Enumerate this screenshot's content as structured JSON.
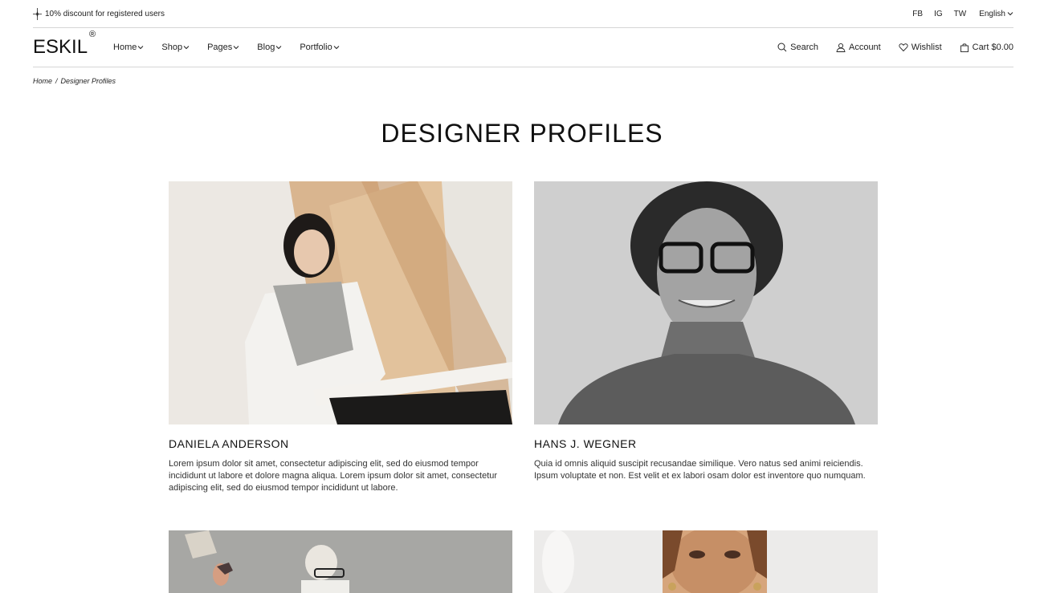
{
  "topbar": {
    "promo": "10% discount for registered users",
    "social": [
      "FB",
      "IG",
      "TW"
    ],
    "language": "English"
  },
  "header": {
    "logo": "ESKIL",
    "logo_mark": "®",
    "nav": [
      {
        "label": "Home"
      },
      {
        "label": "Shop"
      },
      {
        "label": "Pages"
      },
      {
        "label": "Blog"
      },
      {
        "label": "Portfolio"
      }
    ],
    "search_label": "Search",
    "account_label": "Account",
    "wishlist_label": "Wishlist",
    "cart_label": "Cart $0.00"
  },
  "breadcrumb": {
    "home": "Home",
    "separator": "/",
    "current": "Designer Profiles"
  },
  "page_title": "DESIGNER PROFILES",
  "profiles": [
    {
      "name": "DANIELA ANDERSON",
      "bio": "Lorem ipsum dolor sit amet, consectetur adipiscing elit, sed do eiusmod tempor incididunt ut labore et dolore magna aliqua. Lorem ipsum dolor sit amet, consectetur adipiscing elit, sed do eiusmod tempor incididunt ut labore."
    },
    {
      "name": "HANS J. WEGNER",
      "bio": "Quia id omnis aliquid suscipit recusandae similique. Vero natus sed animi reiciendis. Ipsum voluptate et non. Est velit et ex labori osam dolor est inventore quo numquam."
    }
  ],
  "colors": {
    "text": "#1a1a1a",
    "divider": "#d6d6d6",
    "background": "#ffffff"
  }
}
